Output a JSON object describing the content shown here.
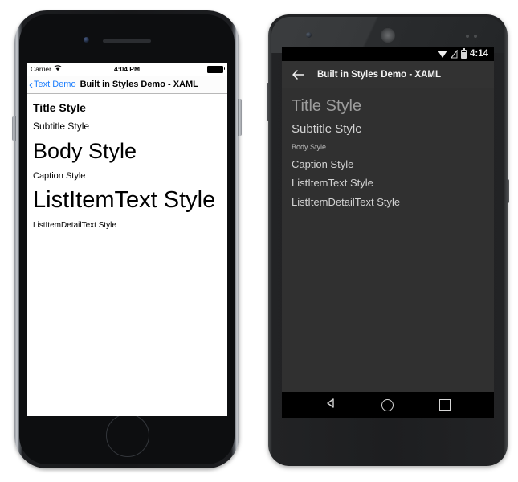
{
  "ios": {
    "status_bar": {
      "carrier": "Carrier",
      "wifi_icon": "wifi-icon",
      "time": "4:04 PM",
      "battery_icon": "battery-full-icon"
    },
    "nav_bar": {
      "back_chevron_icon": "chevron-left-icon",
      "back_label": "Text Demo",
      "title": "Built in Styles Demo - XAML",
      "back_color": "#1d7efd",
      "title_color": "#000000"
    },
    "content": {
      "rows": [
        {
          "label": "Title Style"
        },
        {
          "label": "Subtitle Style"
        },
        {
          "label": "Body Style"
        },
        {
          "label": "Caption Style"
        },
        {
          "label": "ListItemText Style"
        },
        {
          "label": "ListItemDetailText Style"
        }
      ]
    },
    "hardware": {
      "camera_icon": "front-camera-icon",
      "speaker_icon": "earpiece-speaker-icon",
      "home_button_icon": "home-button-icon",
      "power_button_icon": "power-button-icon",
      "volume_button_icon": "volume-button-icon"
    }
  },
  "android": {
    "status_bar": {
      "wifi_icon": "wifi-icon",
      "signal_icon": "no-sim-signal-icon",
      "battery_icon": "battery-icon",
      "time": "4:14"
    },
    "action_bar": {
      "back_arrow_icon": "arrow-left-icon",
      "title": "Built in Styles Demo - XAML",
      "background_color": "#323232",
      "title_color": "#f2f2f2"
    },
    "content": {
      "background_color": "#303030",
      "rows": [
        {
          "label": "Title Style"
        },
        {
          "label": "Subtitle Style"
        },
        {
          "label": "Body Style"
        },
        {
          "label": "Caption Style"
        },
        {
          "label": "ListItemText Style"
        },
        {
          "label": "ListItemDetailText Style"
        }
      ]
    },
    "nav_bar": {
      "back_icon": "nav-back-triangle-icon",
      "home_icon": "nav-home-circle-icon",
      "recents_icon": "nav-recents-square-icon"
    },
    "hardware": {
      "camera_icon": "front-camera-icon",
      "speaker_icon": "earpiece-speaker-icon",
      "volume_button_icon": "volume-button-icon",
      "power_button_icon": "power-button-icon"
    }
  }
}
